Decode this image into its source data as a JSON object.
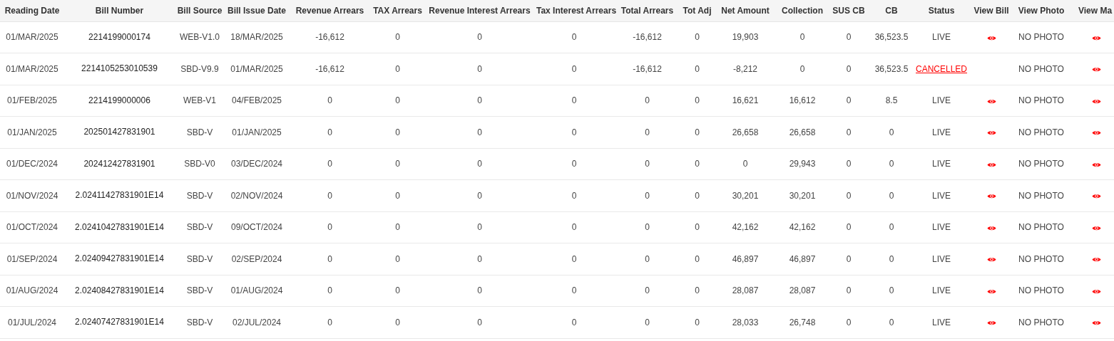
{
  "columns": [
    "Reading Date",
    "Bill Number",
    "Bill Source",
    "Bill Issue Date",
    "Revenue Arrears",
    "TAX Arrears",
    "Revenue Interest Arrears",
    "Tax Interest Arrears",
    "Total Arrears",
    "Tot Adj",
    "Net Amount",
    "Collection",
    "SUS CB",
    "CB",
    "Status",
    "View Bill",
    "View Photo",
    "View Ma"
  ],
  "rows": [
    {
      "cells": [
        "01/MAR/2025",
        "2214199000174",
        "WEB-V1.0",
        "18/MAR/2025",
        "-16,612",
        "0",
        "0",
        "0",
        "-16,612",
        "0",
        "19,903",
        "0",
        "0",
        "36,523.5"
      ],
      "status": {
        "kind": "live",
        "text": "LIVE"
      },
      "view_bill": true,
      "photo": "NO PHOTO"
    },
    {
      "cells": [
        "01/MAR/2025",
        "2214105253010539",
        "SBD-V9.9",
        "01/MAR/2025",
        "-16,612",
        "0",
        "0",
        "0",
        "-16,612",
        "0",
        "-8,212",
        "0",
        "0",
        "36,523.5"
      ],
      "status": {
        "kind": "cancelled",
        "text": "CANCELLED"
      },
      "view_bill": false,
      "photo": "NO PHOTO"
    },
    {
      "cells": [
        "01/FEB/2025",
        "2214199000006",
        "WEB-V1",
        "04/FEB/2025",
        "0",
        "0",
        "0",
        "0",
        "0",
        "0",
        "16,621",
        "16,612",
        "0",
        "8.5"
      ],
      "status": {
        "kind": "live",
        "text": "LIVE"
      },
      "view_bill": true,
      "photo": "NO PHOTO"
    },
    {
      "cells": [
        "01/JAN/2025",
        "202501427831901",
        "SBD-V",
        "01/JAN/2025",
        "0",
        "0",
        "0",
        "0",
        "0",
        "0",
        "26,658",
        "26,658",
        "0",
        "0"
      ],
      "status": {
        "kind": "live",
        "text": "LIVE"
      },
      "view_bill": true,
      "photo": "NO PHOTO"
    },
    {
      "cells": [
        "01/DEC/2024",
        "202412427831901",
        "SBD-V0",
        "03/DEC/2024",
        "0",
        "0",
        "0",
        "0",
        "0",
        "0",
        "0",
        "29,943",
        "0",
        "0"
      ],
      "status": {
        "kind": "live",
        "text": "LIVE"
      },
      "view_bill": true,
      "photo": "NO PHOTO"
    },
    {
      "cells": [
        "01/NOV/2024",
        "2.02411427831901E14",
        "SBD-V",
        "02/NOV/2024",
        "0",
        "0",
        "0",
        "0",
        "0",
        "0",
        "30,201",
        "30,201",
        "0",
        "0"
      ],
      "status": {
        "kind": "live",
        "text": "LIVE"
      },
      "view_bill": true,
      "photo": "NO PHOTO"
    },
    {
      "cells": [
        "01/OCT/2024",
        "2.02410427831901E14",
        "SBD-V",
        "09/OCT/2024",
        "0",
        "0",
        "0",
        "0",
        "0",
        "0",
        "42,162",
        "42,162",
        "0",
        "0"
      ],
      "status": {
        "kind": "live",
        "text": "LIVE"
      },
      "view_bill": true,
      "photo": "NO PHOTO"
    },
    {
      "cells": [
        "01/SEP/2024",
        "2.02409427831901E14",
        "SBD-V",
        "02/SEP/2024",
        "0",
        "0",
        "0",
        "0",
        "0",
        "0",
        "46,897",
        "46,897",
        "0",
        "0"
      ],
      "status": {
        "kind": "live",
        "text": "LIVE"
      },
      "view_bill": true,
      "photo": "NO PHOTO"
    },
    {
      "cells": [
        "01/AUG/2024",
        "2.02408427831901E14",
        "SBD-V",
        "01/AUG/2024",
        "0",
        "0",
        "0",
        "0",
        "0",
        "0",
        "28,087",
        "28,087",
        "0",
        "0"
      ],
      "status": {
        "kind": "live",
        "text": "LIVE"
      },
      "view_bill": true,
      "photo": "NO PHOTO"
    },
    {
      "cells": [
        "01/JUL/2024",
        "2.02407427831901E14",
        "SBD-V",
        "02/JUL/2024",
        "0",
        "0",
        "0",
        "0",
        "0",
        "0",
        "28,033",
        "26,748",
        "0",
        "0"
      ],
      "status": {
        "kind": "live",
        "text": "LIVE"
      },
      "view_bill": true,
      "photo": "NO PHOTO"
    }
  ]
}
